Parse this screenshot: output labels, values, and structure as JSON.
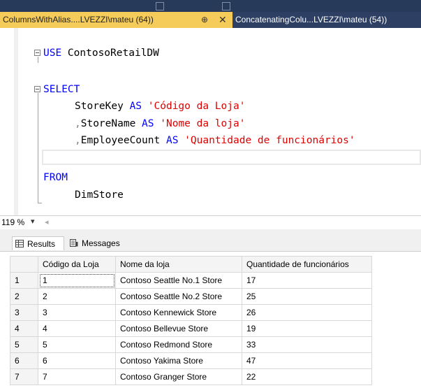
{
  "tabs": {
    "active": {
      "title": "ColumnsWithAlias....LVEZZI\\mateu (64))",
      "pin": "⊕",
      "close": "✕"
    },
    "inactive": {
      "title": "ConcatenatingColu...LVEZZI\\mateu (54))"
    }
  },
  "editor": {
    "line1": {
      "kw": "USE",
      "rest": " ContosoRetailDW"
    },
    "line2": {
      "kw": "SELECT"
    },
    "line3": {
      "ident": "StoreKey",
      "as": "AS",
      "alias": "'Código da Loja'"
    },
    "line4": {
      "comma": ",",
      "ident": "StoreName",
      "as": "AS",
      "alias": "'Nome da loja'"
    },
    "line5": {
      "comma": ",",
      "ident": "EmployeeCount",
      "as": "AS",
      "alias": "'Quantidade de funcionários'"
    },
    "line6": {
      "kw": "FROM"
    },
    "line7": {
      "ident": "DimStore"
    }
  },
  "status": {
    "zoom": "119 %",
    "zoom_arrow": "▾",
    "scroll_arrow": "◂"
  },
  "results": {
    "tab_results": "Results",
    "tab_messages": "Messages",
    "columns": [
      "",
      "Código da Loja",
      "Nome da loja",
      "Quantidade de funcionários"
    ],
    "rows": [
      [
        "1",
        "1",
        "Contoso Seattle No.1 Store",
        "17"
      ],
      [
        "2",
        "2",
        "Contoso Seattle No.2 Store",
        "25"
      ],
      [
        "3",
        "3",
        "Contoso Kennewick Store",
        "26"
      ],
      [
        "4",
        "4",
        "Contoso Bellevue Store",
        "19"
      ],
      [
        "5",
        "5",
        "Contoso Redmond Store",
        "33"
      ],
      [
        "6",
        "6",
        "Contoso Yakima Store",
        "47"
      ],
      [
        "7",
        "7",
        "Contoso Granger Store",
        "22"
      ]
    ]
  },
  "colors": {
    "active_tab": "#f5cc5a",
    "tab_bar": "#2d4064",
    "keyword": "#0000ff",
    "string": "#e00000",
    "operator": "#808080"
  }
}
